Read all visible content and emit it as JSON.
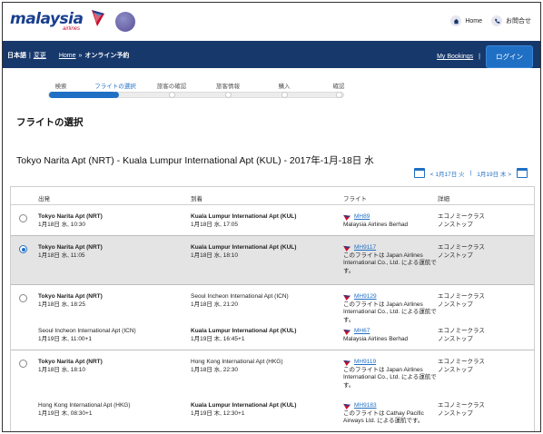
{
  "header": {
    "logo_text": "malaysia",
    "logo_sub": "airlines",
    "home_label": "Home",
    "contact_label": "お問合せ"
  },
  "nav": {
    "language": "日本語",
    "change": "変更",
    "home": "Home",
    "arrow": "»",
    "current": "オンライン予約",
    "my_bookings": "My Bookings",
    "separator": "|",
    "login": "ログイン"
  },
  "progress": {
    "steps": [
      "検索",
      "フライトの選択",
      "旅客の確認",
      "旅客情報",
      "購入",
      "確認"
    ],
    "active_index": 1
  },
  "page_title": "フライトの選択",
  "route_title": "Tokyo Narita Apt (NRT) - Kuala Lumpur International Apt (KUL) - 2017年-1月-18日 水",
  "datenav": {
    "prev": "< 1月17日 火",
    "sep": "|",
    "next": "1月19日 木 >"
  },
  "table": {
    "headers": {
      "dep": "出発",
      "arr": "到着",
      "flight": "フライト",
      "detail": "詳細"
    },
    "rows": [
      {
        "dep": "Tokyo Narita Apt (NRT)",
        "dep_time": "1月18日 水, 10:30",
        "arr": "Kuala Lumpur International Apt (KUL)",
        "arr_time": "1月18日 水, 17:05",
        "flight": "MH89",
        "operator": "Malaysia Airlines Berhad",
        "cabin": "エコノミークラス",
        "stops": "ノンストップ"
      },
      {
        "dep": "Tokyo Narita Apt (NRT)",
        "dep_time": "1月18日 水, 11:05",
        "arr": "Kuala Lumpur International Apt (KUL)",
        "arr_time": "1月18日 水, 18:10",
        "flight": "MH9117",
        "operator": "このフライトは Japan Airlines International Co., Ltd. による運航です。",
        "cabin": "エコノミークラス",
        "stops": "ノンストップ"
      },
      {
        "dep": "Tokyo Narita Apt (NRT)",
        "dep_time": "1月18日 水, 18:25",
        "arr": "Seoul Incheon International Apt (ICN)",
        "arr_time": "1月18日 水, 21:20",
        "flight": "MH9129",
        "operator": "このフライトは Japan Airlines International Co., Ltd. による運航です。",
        "cabin": "エコノミークラス",
        "stops": "ノンストップ"
      },
      {
        "dep": "Seoul Incheon International Apt (ICN)",
        "dep_time": "1月19日 木, 11:00+1",
        "arr": "Kuala Lumpur International Apt (KUL)",
        "arr_time": "1月19日 木, 16:45+1",
        "flight": "MH67",
        "operator": "Malaysia Airlines Berhad",
        "cabin": "エコノミークラス",
        "stops": "ノンストップ"
      },
      {
        "dep": "Tokyo Narita Apt (NRT)",
        "dep_time": "1月18日 水, 18:10",
        "arr": "Hong Kong International Apt (HKG)",
        "arr_time": "1月18日 水, 22:30",
        "flight": "MH9119",
        "operator": "このフライトは Japan Airlines International Co., Ltd. による運航です。",
        "cabin": "エコノミークラス",
        "stops": "ノンストップ"
      },
      {
        "dep": "Hong Kong International Apt (HKG)",
        "dep_time": "1月19日 木, 08:30+1",
        "arr": "Kuala Lumpur International Apt (KUL)",
        "arr_time": "1月19日 木, 12:30+1",
        "flight": "MH9183",
        "operator": "このフライトは Cathay Pacific Airways Ltd. による運航です。",
        "cabin": "エコノミークラス",
        "stops": "ノンストップ"
      }
    ]
  },
  "colors": {
    "brand_navy": "#16386b",
    "accent_blue": "#1f6fc4",
    "brand_red": "#c8102e"
  }
}
